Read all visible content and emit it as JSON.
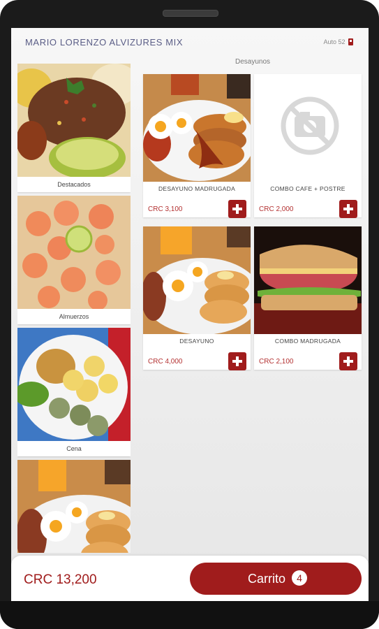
{
  "header": {
    "store_name": "MARIO LORENZO ALVIZURES MIX",
    "device_label": "Auto 52"
  },
  "section_title": "Desayunos",
  "categories": [
    {
      "label": "Destacados"
    },
    {
      "label": "Almuerzos"
    },
    {
      "label": "Cena"
    },
    {
      "label": ""
    }
  ],
  "products": [
    {
      "name": "DESAYUNO MADRUGADA",
      "price": "CRC 3,100"
    },
    {
      "name": "COMBO CAFE + POSTRE",
      "price": "CRC 2,000"
    },
    {
      "name": "DESAYUNO",
      "price": "CRC 4,000"
    },
    {
      "name": "COMBO MADRUGADA",
      "price": "CRC 2,100"
    }
  ],
  "footer": {
    "total": "CRC 13,200",
    "cart_label": "Carrito",
    "cart_count": "4"
  },
  "colors": {
    "accent": "#a01c1c",
    "title": "#5a5d86"
  }
}
